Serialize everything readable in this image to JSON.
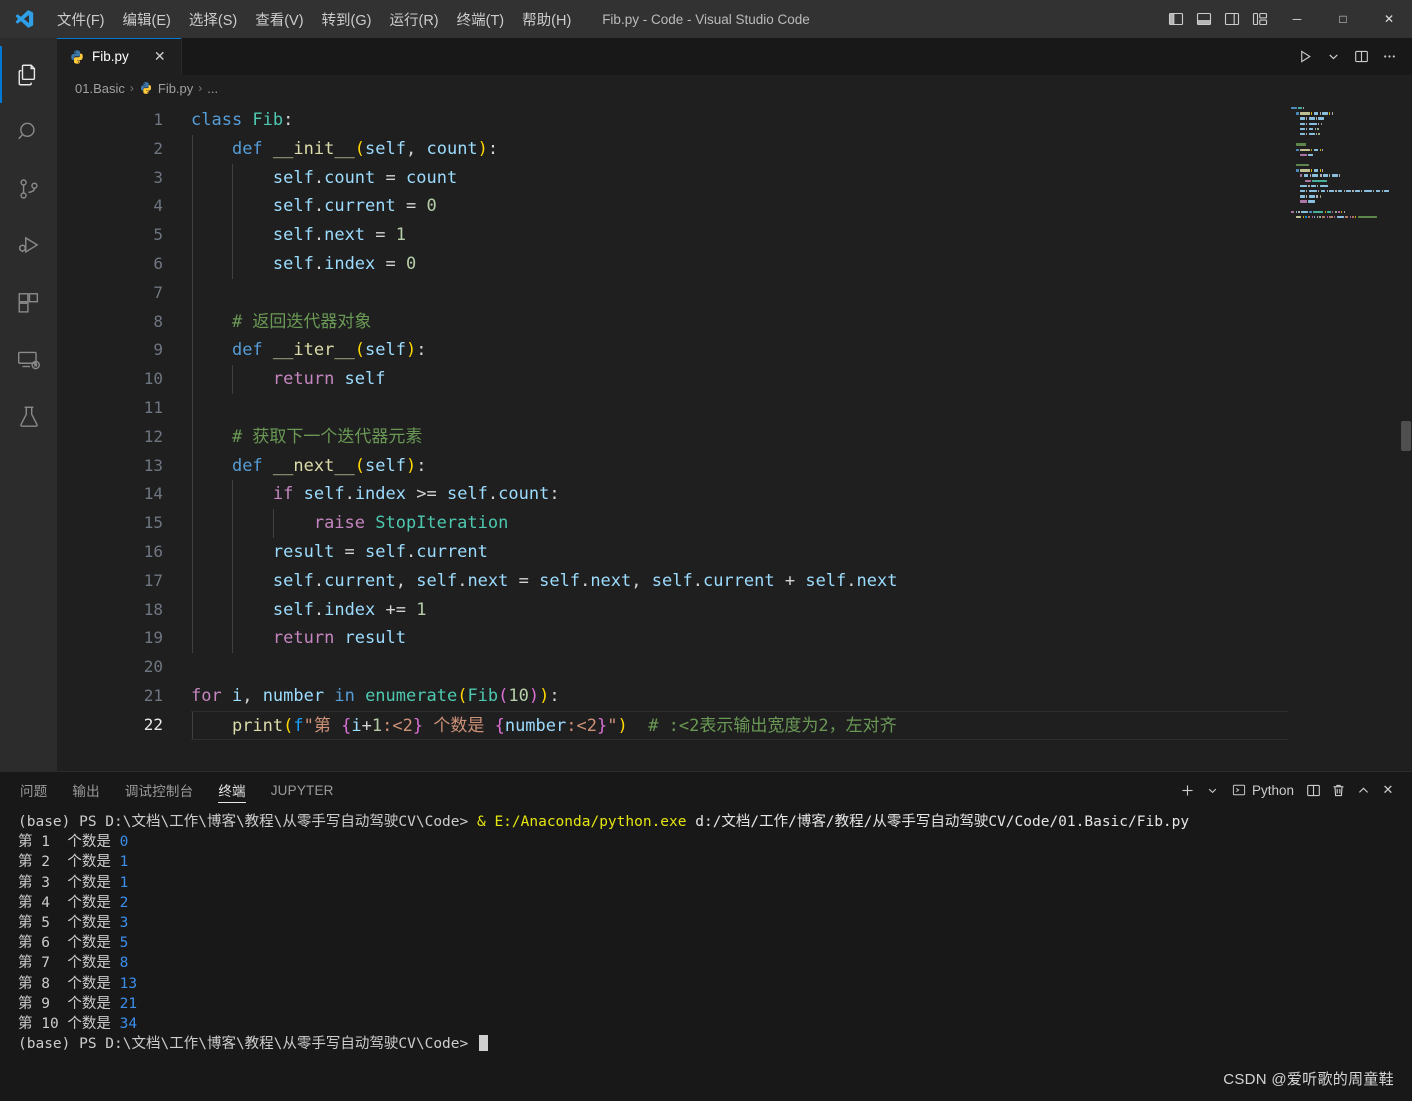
{
  "titlebar": {
    "app_title": "Fib.py - Code - Visual Studio Code",
    "menus": [
      {
        "label": "文件(F)",
        "name": "menu-file"
      },
      {
        "label": "编辑(E)",
        "name": "menu-edit"
      },
      {
        "label": "选择(S)",
        "name": "menu-selection"
      },
      {
        "label": "查看(V)",
        "name": "menu-view"
      },
      {
        "label": "转到(G)",
        "name": "menu-go"
      },
      {
        "label": "运行(R)",
        "name": "menu-run"
      },
      {
        "label": "终端(T)",
        "name": "menu-terminal"
      },
      {
        "label": "帮助(H)",
        "name": "menu-help"
      }
    ],
    "layout_controls": [
      "toggle-primary-sidebar",
      "toggle-panel",
      "toggle-secondary-sidebar",
      "customize-layout"
    ],
    "window_controls": {
      "minimize": "─",
      "maximize": "□",
      "close": "✕"
    }
  },
  "activitybar": {
    "items": [
      {
        "name": "activitybar-explorer",
        "icon": "files-icon",
        "active": true
      },
      {
        "name": "activitybar-search",
        "icon": "search-icon",
        "active": false
      },
      {
        "name": "activitybar-source-control",
        "icon": "source-control-icon",
        "active": false
      },
      {
        "name": "activitybar-run-debug",
        "icon": "run-and-debug-icon",
        "active": false
      },
      {
        "name": "activitybar-extensions",
        "icon": "extensions-icon",
        "active": false
      },
      {
        "name": "activitybar-remote-explorer",
        "icon": "remote-explorer-icon",
        "active": false
      },
      {
        "name": "activitybar-testing",
        "icon": "beaker-icon",
        "active": false
      }
    ]
  },
  "tabs": {
    "open": [
      {
        "label": "Fib.py",
        "icon": "python-icon",
        "active": true,
        "close": "✕"
      }
    ],
    "editor_actions": [
      "run-python-file",
      "run-options-chevron",
      "split-editor-right",
      "more-actions"
    ]
  },
  "breadcrumb": {
    "segments": [
      "01.Basic",
      "Fib.py",
      "..."
    ],
    "separator": "›"
  },
  "editor": {
    "language": "Python",
    "active_line": 22,
    "lines": [
      {
        "n": 1,
        "guides": 0,
        "tokens": [
          {
            "t": "class ",
            "c": "t-kw"
          },
          {
            "t": "Fib",
            "c": "t-cls"
          },
          {
            "t": ":",
            "c": "t-plain"
          }
        ]
      },
      {
        "n": 2,
        "guides": 1,
        "tokens": [
          {
            "t": "    ",
            "c": "t-plain"
          },
          {
            "t": "def ",
            "c": "t-kw"
          },
          {
            "t": "__init__",
            "c": "t-fn"
          },
          {
            "t": "(",
            "c": "t-punc"
          },
          {
            "t": "self",
            "c": "t-var"
          },
          {
            "t": ", ",
            "c": "t-plain"
          },
          {
            "t": "count",
            "c": "t-var"
          },
          {
            "t": ")",
            "c": "t-punc"
          },
          {
            "t": ":",
            "c": "t-plain"
          }
        ]
      },
      {
        "n": 3,
        "guides": 2,
        "tokens": [
          {
            "t": "        ",
            "c": "t-plain"
          },
          {
            "t": "self",
            "c": "t-var"
          },
          {
            "t": ".",
            "c": "t-plain"
          },
          {
            "t": "count",
            "c": "t-var"
          },
          {
            "t": " = ",
            "c": "t-op"
          },
          {
            "t": "count",
            "c": "t-var"
          }
        ]
      },
      {
        "n": 4,
        "guides": 2,
        "tokens": [
          {
            "t": "        ",
            "c": "t-plain"
          },
          {
            "t": "self",
            "c": "t-var"
          },
          {
            "t": ".",
            "c": "t-plain"
          },
          {
            "t": "current",
            "c": "t-var"
          },
          {
            "t": " = ",
            "c": "t-op"
          },
          {
            "t": "0",
            "c": "t-num"
          }
        ]
      },
      {
        "n": 5,
        "guides": 2,
        "tokens": [
          {
            "t": "        ",
            "c": "t-plain"
          },
          {
            "t": "self",
            "c": "t-var"
          },
          {
            "t": ".",
            "c": "t-plain"
          },
          {
            "t": "next",
            "c": "t-var"
          },
          {
            "t": " = ",
            "c": "t-op"
          },
          {
            "t": "1",
            "c": "t-num"
          }
        ]
      },
      {
        "n": 6,
        "guides": 2,
        "tokens": [
          {
            "t": "        ",
            "c": "t-plain"
          },
          {
            "t": "self",
            "c": "t-var"
          },
          {
            "t": ".",
            "c": "t-plain"
          },
          {
            "t": "index",
            "c": "t-var"
          },
          {
            "t": " = ",
            "c": "t-op"
          },
          {
            "t": "0",
            "c": "t-num"
          }
        ]
      },
      {
        "n": 7,
        "guides": 1,
        "tokens": []
      },
      {
        "n": 8,
        "guides": 1,
        "tokens": [
          {
            "t": "    ",
            "c": "t-plain"
          },
          {
            "t": "# 返回迭代器对象",
            "c": "t-cmt"
          }
        ]
      },
      {
        "n": 9,
        "guides": 1,
        "tokens": [
          {
            "t": "    ",
            "c": "t-plain"
          },
          {
            "t": "def ",
            "c": "t-kw"
          },
          {
            "t": "__iter__",
            "c": "t-fn"
          },
          {
            "t": "(",
            "c": "t-punc"
          },
          {
            "t": "self",
            "c": "t-var"
          },
          {
            "t": ")",
            "c": "t-punc"
          },
          {
            "t": ":",
            "c": "t-plain"
          }
        ]
      },
      {
        "n": 10,
        "guides": 2,
        "tokens": [
          {
            "t": "        ",
            "c": "t-plain"
          },
          {
            "t": "return ",
            "c": "t-ctl"
          },
          {
            "t": "self",
            "c": "t-var"
          }
        ]
      },
      {
        "n": 11,
        "guides": 1,
        "tokens": []
      },
      {
        "n": 12,
        "guides": 1,
        "tokens": [
          {
            "t": "    ",
            "c": "t-plain"
          },
          {
            "t": "# 获取下一个迭代器元素",
            "c": "t-cmt"
          }
        ]
      },
      {
        "n": 13,
        "guides": 1,
        "tokens": [
          {
            "t": "    ",
            "c": "t-plain"
          },
          {
            "t": "def ",
            "c": "t-kw"
          },
          {
            "t": "__next__",
            "c": "t-fn"
          },
          {
            "t": "(",
            "c": "t-punc"
          },
          {
            "t": "self",
            "c": "t-var"
          },
          {
            "t": ")",
            "c": "t-punc"
          },
          {
            "t": ":",
            "c": "t-plain"
          }
        ]
      },
      {
        "n": 14,
        "guides": 2,
        "tokens": [
          {
            "t": "        ",
            "c": "t-plain"
          },
          {
            "t": "if ",
            "c": "t-ctl"
          },
          {
            "t": "self",
            "c": "t-var"
          },
          {
            "t": ".",
            "c": "t-plain"
          },
          {
            "t": "index",
            "c": "t-var"
          },
          {
            "t": " >= ",
            "c": "t-op"
          },
          {
            "t": "self",
            "c": "t-var"
          },
          {
            "t": ".",
            "c": "t-plain"
          },
          {
            "t": "count",
            "c": "t-var"
          },
          {
            "t": ":",
            "c": "t-plain"
          }
        ]
      },
      {
        "n": 15,
        "guides": 3,
        "tokens": [
          {
            "t": "            ",
            "c": "t-plain"
          },
          {
            "t": "raise ",
            "c": "t-ctl"
          },
          {
            "t": "StopIteration",
            "c": "t-cls"
          }
        ]
      },
      {
        "n": 16,
        "guides": 2,
        "tokens": [
          {
            "t": "        ",
            "c": "t-plain"
          },
          {
            "t": "result",
            "c": "t-var"
          },
          {
            "t": " = ",
            "c": "t-op"
          },
          {
            "t": "self",
            "c": "t-var"
          },
          {
            "t": ".",
            "c": "t-plain"
          },
          {
            "t": "current",
            "c": "t-var"
          }
        ]
      },
      {
        "n": 17,
        "guides": 2,
        "tokens": [
          {
            "t": "        ",
            "c": "t-plain"
          },
          {
            "t": "self",
            "c": "t-var"
          },
          {
            "t": ".",
            "c": "t-plain"
          },
          {
            "t": "current",
            "c": "t-var"
          },
          {
            "t": ", ",
            "c": "t-plain"
          },
          {
            "t": "self",
            "c": "t-var"
          },
          {
            "t": ".",
            "c": "t-plain"
          },
          {
            "t": "next",
            "c": "t-var"
          },
          {
            "t": " = ",
            "c": "t-op"
          },
          {
            "t": "self",
            "c": "t-var"
          },
          {
            "t": ".",
            "c": "t-plain"
          },
          {
            "t": "next",
            "c": "t-var"
          },
          {
            "t": ", ",
            "c": "t-plain"
          },
          {
            "t": "self",
            "c": "t-var"
          },
          {
            "t": ".",
            "c": "t-plain"
          },
          {
            "t": "current",
            "c": "t-var"
          },
          {
            "t": " + ",
            "c": "t-op"
          },
          {
            "t": "self",
            "c": "t-var"
          },
          {
            "t": ".",
            "c": "t-plain"
          },
          {
            "t": "next",
            "c": "t-var"
          }
        ]
      },
      {
        "n": 18,
        "guides": 2,
        "tokens": [
          {
            "t": "        ",
            "c": "t-plain"
          },
          {
            "t": "self",
            "c": "t-var"
          },
          {
            "t": ".",
            "c": "t-plain"
          },
          {
            "t": "index",
            "c": "t-var"
          },
          {
            "t": " += ",
            "c": "t-op"
          },
          {
            "t": "1",
            "c": "t-num"
          }
        ]
      },
      {
        "n": 19,
        "guides": 2,
        "tokens": [
          {
            "t": "        ",
            "c": "t-plain"
          },
          {
            "t": "return ",
            "c": "t-ctl"
          },
          {
            "t": "result",
            "c": "t-var"
          }
        ]
      },
      {
        "n": 20,
        "guides": 0,
        "tokens": []
      },
      {
        "n": 21,
        "guides": 0,
        "tokens": [
          {
            "t": "for ",
            "c": "t-ctl"
          },
          {
            "t": "i",
            "c": "t-var"
          },
          {
            "t": ", ",
            "c": "t-plain"
          },
          {
            "t": "number",
            "c": "t-var"
          },
          {
            "t": " in ",
            "c": "t-kw"
          },
          {
            "t": "enumerate",
            "c": "t-cls"
          },
          {
            "t": "(",
            "c": "t-punc"
          },
          {
            "t": "Fib",
            "c": "t-cls"
          },
          {
            "t": "(",
            "c": "t-punc2"
          },
          {
            "t": "10",
            "c": "t-num"
          },
          {
            "t": ")",
            "c": "t-punc2"
          },
          {
            "t": ")",
            "c": "t-punc"
          },
          {
            "t": ":",
            "c": "t-plain"
          }
        ]
      },
      {
        "n": 22,
        "guides": 1,
        "tokens": [
          {
            "t": "    ",
            "c": "t-plain"
          },
          {
            "t": "print",
            "c": "t-fn"
          },
          {
            "t": "(",
            "c": "t-punc"
          },
          {
            "t": "f",
            "c": "t-punc3"
          },
          {
            "t": "\"第 ",
            "c": "t-str"
          },
          {
            "t": "{",
            "c": "t-punc2"
          },
          {
            "t": "i",
            "c": "t-var"
          },
          {
            "t": "+",
            "c": "t-op"
          },
          {
            "t": "1",
            "c": "t-num"
          },
          {
            "t": ":<2",
            "c": "t-str"
          },
          {
            "t": "}",
            "c": "t-punc2"
          },
          {
            "t": " 个数是 ",
            "c": "t-str"
          },
          {
            "t": "{",
            "c": "t-punc2"
          },
          {
            "t": "number",
            "c": "t-var"
          },
          {
            "t": ":<2",
            "c": "t-str"
          },
          {
            "t": "}",
            "c": "t-punc2"
          },
          {
            "t": "\"",
            "c": "t-str"
          },
          {
            "t": ")",
            "c": "t-punc"
          },
          {
            "t": "  # :<2表示输出宽度为2，左对齐",
            "c": "t-cmt"
          }
        ]
      }
    ]
  },
  "panel": {
    "tabs": [
      {
        "label": "问题",
        "name": "panel-tab-problems",
        "active": false
      },
      {
        "label": "输出",
        "name": "panel-tab-output",
        "active": false
      },
      {
        "label": "调试控制台",
        "name": "panel-tab-debug-console",
        "active": false
      },
      {
        "label": "终端",
        "name": "panel-tab-terminal",
        "active": true
      },
      {
        "label": "JUPYTER",
        "name": "panel-tab-jupyter",
        "active": false
      }
    ],
    "actions": {
      "new_terminal": "+",
      "new_terminal_chevron": "⌄",
      "shell_label": "Python",
      "split": "split-terminal",
      "kill": "trash-icon",
      "maximize": "chevron-up-icon",
      "close": "✕"
    }
  },
  "terminal": {
    "prompt_line": {
      "prompt": "(base) PS D:\\文档\\工作\\博客\\教程\\从零手写自动驾驶CV\\Code> ",
      "command_exe": "& E:/Anaconda/python.exe ",
      "command_arg": "d:/文档/工作/博客/教程/从零手写自动驾驶CV/Code/01.Basic/Fib.py"
    },
    "output": [
      {
        "label": "第 1  个数是 ",
        "value": "0"
      },
      {
        "label": "第 2  个数是 ",
        "value": "1"
      },
      {
        "label": "第 3  个数是 ",
        "value": "1"
      },
      {
        "label": "第 4  个数是 ",
        "value": "2"
      },
      {
        "label": "第 5  个数是 ",
        "value": "3"
      },
      {
        "label": "第 6  个数是 ",
        "value": "5"
      },
      {
        "label": "第 7  个数是 ",
        "value": "8"
      },
      {
        "label": "第 8  个数是 ",
        "value": "13"
      },
      {
        "label": "第 9  个数是 ",
        "value": "21"
      },
      {
        "label": "第 10 个数是 ",
        "value": "34"
      }
    ],
    "final_prompt": "(base) PS D:\\文档\\工作\\博客\\教程\\从零手写自动驾驶CV\\Code> "
  },
  "watermark": "CSDN @爱听歌的周童鞋",
  "colors": {
    "accent": "#0078d4",
    "editor_bg": "#1f1f1f",
    "panel_bg": "#181818",
    "titlebar_bg": "#323233",
    "activitybar_bg": "#2c2c2d"
  }
}
